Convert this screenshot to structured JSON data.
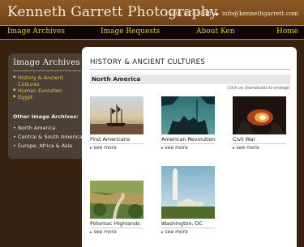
{
  "header": {
    "site_title": "Kenneth Garrett Photography",
    "phone": "(540) 347-5848",
    "email": "info@kennethgarrett.com"
  },
  "nav": [
    {
      "label": "Image Archives"
    },
    {
      "label": "Image Requests"
    },
    {
      "label": "About Ken"
    },
    {
      "label": "Home"
    }
  ],
  "sidebar": {
    "title": "Image Archives",
    "items": [
      {
        "label": "History & Ancient Cultures"
      },
      {
        "label": "Human Evolution"
      },
      {
        "label": "Egypt"
      }
    ],
    "other_title": "Other Image Archives:",
    "other_items": [
      {
        "label": "North America"
      },
      {
        "label": "Central & South America"
      },
      {
        "label": "Europe, Africa & Asia"
      }
    ]
  },
  "content": {
    "title": "HISTORY & ANCIENT CULTURES",
    "section": "North America",
    "hint": "Click on thumbnails to enlarge",
    "thumbnails": [
      {
        "caption": "First Americans",
        "more": "see more"
      },
      {
        "caption": "American Revolution",
        "more": "see more"
      },
      {
        "caption": "Civil War",
        "more": "see more"
      },
      {
        "caption": "Potomac Highlands",
        "more": "see more"
      },
      {
        "caption": "Washington, DC",
        "more": "see more"
      }
    ]
  },
  "icons": {
    "contact_separator": "diamond-icon",
    "list_bullet": "diamond-bullet-icon",
    "see_more": "chevron-right-icon"
  },
  "colors": {
    "header_bg": "#7d4f1e",
    "nav_bg": "#0e0704",
    "nav_link": "#e6c64a",
    "page_bg": "#3a2210",
    "sidebar_bg": "#4b4038",
    "sidebar_link": "#e7c24b"
  }
}
